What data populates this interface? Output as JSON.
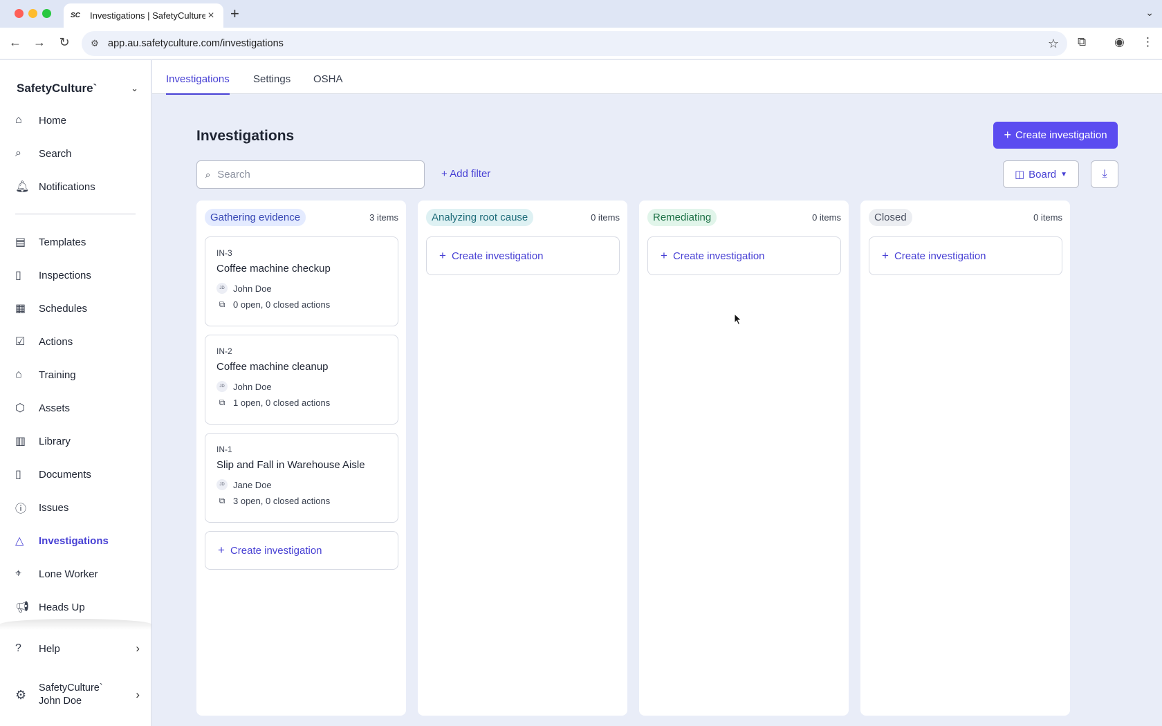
{
  "browser": {
    "tab_title": "Investigations | SafetyCulture",
    "tab_favicon": "SC",
    "url": "app.au.safetyculture.com/investigations"
  },
  "sidebar": {
    "org_name": "SafetyCulture`",
    "items": [
      {
        "label": "Home",
        "icon": "home-icon"
      },
      {
        "label": "Search",
        "icon": "search-icon"
      },
      {
        "label": "Notifications",
        "icon": "bell-icon"
      },
      {
        "label": "Templates",
        "icon": "templates-icon"
      },
      {
        "label": "Inspections",
        "icon": "clipboard-icon"
      },
      {
        "label": "Schedules",
        "icon": "calendar-icon"
      },
      {
        "label": "Actions",
        "icon": "check-square-icon"
      },
      {
        "label": "Training",
        "icon": "graduation-cap-icon"
      },
      {
        "label": "Assets",
        "icon": "cube-icon"
      },
      {
        "label": "Library",
        "icon": "library-icon"
      },
      {
        "label": "Documents",
        "icon": "document-icon"
      },
      {
        "label": "Issues",
        "icon": "alert-icon"
      },
      {
        "label": "Investigations",
        "icon": "investigation-icon",
        "active": true
      },
      {
        "label": "Lone Worker",
        "icon": "map-pin-icon"
      },
      {
        "label": "Heads Up",
        "icon": "megaphone-icon"
      }
    ],
    "help_label": "Help",
    "account_org": "SafetyCulture`",
    "account_user": "John Doe"
  },
  "page_tabs": [
    "Investigations",
    "Settings",
    "OSHA"
  ],
  "main": {
    "title": "Investigations",
    "create_button": "Create investigation",
    "search_placeholder": "Search",
    "add_filter": "+ Add filter",
    "view_label": "Board"
  },
  "columns": [
    {
      "status": "Gathering evidence",
      "count": "3 items",
      "cards": [
        {
          "id": "IN-3",
          "title": "Coffee machine checkup",
          "initials": "JD",
          "assignee": "John Doe",
          "actions": "0 open, 0 closed actions"
        },
        {
          "id": "IN-2",
          "title": "Coffee machine cleanup",
          "initials": "JD",
          "assignee": "John Doe",
          "actions": "1 open, 0 closed actions"
        },
        {
          "id": "IN-1",
          "title": "Slip and Fall in Warehouse Aisle",
          "initials": "JD",
          "assignee": "Jane Doe",
          "actions": "3 open, 0 closed actions"
        }
      ],
      "create_label": "Create investigation"
    },
    {
      "status": "Analyzing root cause",
      "count": "0 items",
      "cards": [],
      "create_label": "Create investigation"
    },
    {
      "status": "Remediating",
      "count": "0 items",
      "cards": [],
      "create_label": "Create investigation"
    },
    {
      "status": "Closed",
      "count": "0 items",
      "cards": [],
      "create_label": "Create investigation"
    }
  ],
  "colors": {
    "accent": "#5b4cf0",
    "link": "#4740d4",
    "background": "#e9edf8"
  }
}
